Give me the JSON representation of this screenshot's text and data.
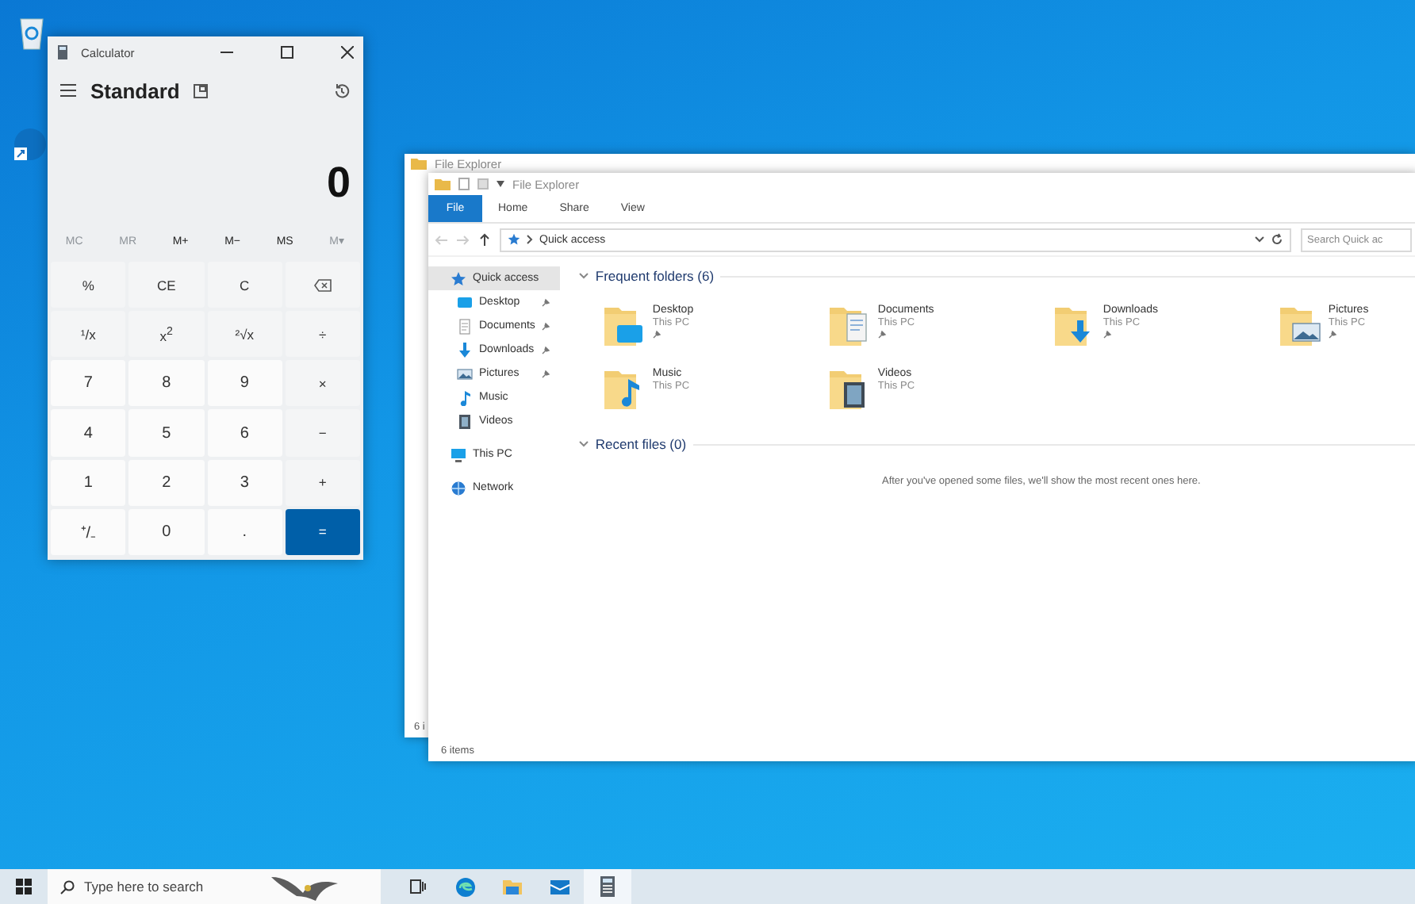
{
  "calculator": {
    "title": "Calculator",
    "mode": "Standard",
    "display": "0",
    "memory": [
      {
        "label": "MC",
        "disabled": true
      },
      {
        "label": "MR",
        "disabled": true
      },
      {
        "label": "M+",
        "disabled": false
      },
      {
        "label": "M−",
        "disabled": false
      },
      {
        "label": "MS",
        "disabled": false
      },
      {
        "label": "M▾",
        "disabled": true
      }
    ],
    "keys": [
      {
        "label": "%",
        "kind": "function"
      },
      {
        "label": "CE",
        "kind": "function"
      },
      {
        "label": "C",
        "kind": "function"
      },
      {
        "kind": "backspace"
      },
      {
        "label": "¹/x",
        "kind": "function"
      },
      {
        "label": "x$^{2}$",
        "kind": "function"
      },
      {
        "label": "²√x",
        "kind": "function"
      },
      {
        "label": "÷",
        "kind": "function"
      },
      {
        "label": "7",
        "kind": "digit"
      },
      {
        "label": "8",
        "kind": "digit"
      },
      {
        "label": "9",
        "kind": "digit"
      },
      {
        "label": "×",
        "kind": "function"
      },
      {
        "label": "4",
        "kind": "digit"
      },
      {
        "label": "5",
        "kind": "digit"
      },
      {
        "label": "6",
        "kind": "digit"
      },
      {
        "label": "−",
        "kind": "function"
      },
      {
        "label": "1",
        "kind": "digit"
      },
      {
        "label": "2",
        "kind": "digit"
      },
      {
        "label": "3",
        "kind": "digit"
      },
      {
        "label": "+",
        "kind": "function"
      },
      {
        "label": "⁺/₋",
        "kind": "digit"
      },
      {
        "label": "0",
        "kind": "digit"
      },
      {
        "label": ".",
        "kind": "digit"
      },
      {
        "label": "=",
        "kind": "equals"
      }
    ]
  },
  "back_window": {
    "title": "File Explorer",
    "status": "6 i"
  },
  "explorer": {
    "title": "File Explorer",
    "ribbon_tabs": [
      {
        "label": "File",
        "selected": true
      },
      {
        "label": "Home",
        "selected": false
      },
      {
        "label": "Share",
        "selected": false
      },
      {
        "label": "View",
        "selected": false
      }
    ],
    "address": "Quick access",
    "search": {
      "placeholder": "Search Quick ac"
    },
    "nav": [
      {
        "label": "Quick access",
        "kind": "star",
        "selected": true,
        "pinned": false,
        "children": [
          {
            "label": "Desktop",
            "kind": "desktop",
            "selected": false,
            "pinned": true
          },
          {
            "label": "Documents",
            "kind": "documents",
            "selected": false,
            "pinned": true
          },
          {
            "label": "Downloads",
            "kind": "downloads",
            "selected": false,
            "pinned": true
          },
          {
            "label": "Pictures",
            "kind": "pictures",
            "selected": false,
            "pinned": true
          },
          {
            "label": "Music",
            "kind": "music",
            "selected": false,
            "pinned": false
          },
          {
            "label": "Videos",
            "kind": "videos",
            "selected": false,
            "pinned": false
          }
        ]
      },
      {
        "label": "This PC",
        "kind": "pc",
        "selected": false,
        "pinned": false
      },
      {
        "label": "Network",
        "kind": "network",
        "selected": false,
        "pinned": false
      }
    ],
    "frequent": {
      "heading": "Frequent folders (6)",
      "items": [
        {
          "name": "Desktop",
          "location": "This PC",
          "kind": "desktop",
          "pinned": true
        },
        {
          "name": "Documents",
          "location": "This PC",
          "kind": "documents",
          "pinned": true
        },
        {
          "name": "Downloads",
          "location": "This PC",
          "kind": "downloads",
          "pinned": true
        },
        {
          "name": "Pictures",
          "location": "This PC",
          "kind": "pictures",
          "pinned": true
        },
        {
          "name": "Music",
          "location": "This PC",
          "kind": "music",
          "pinned": false
        },
        {
          "name": "Videos",
          "location": "This PC",
          "kind": "videos",
          "pinned": false
        }
      ]
    },
    "recent": {
      "heading": "Recent files (0)",
      "message": "After you've opened some files, we'll show the most recent ones here."
    },
    "status": "6 items"
  },
  "taskbar": {
    "search": {
      "placeholder": "Type here to search"
    },
    "apps": [
      {
        "kind": "task-view",
        "active": false
      },
      {
        "kind": "edge",
        "active": false
      },
      {
        "kind": "explorer",
        "active": false
      },
      {
        "kind": "mail",
        "active": false
      },
      {
        "kind": "calculator",
        "active": true
      }
    ]
  }
}
